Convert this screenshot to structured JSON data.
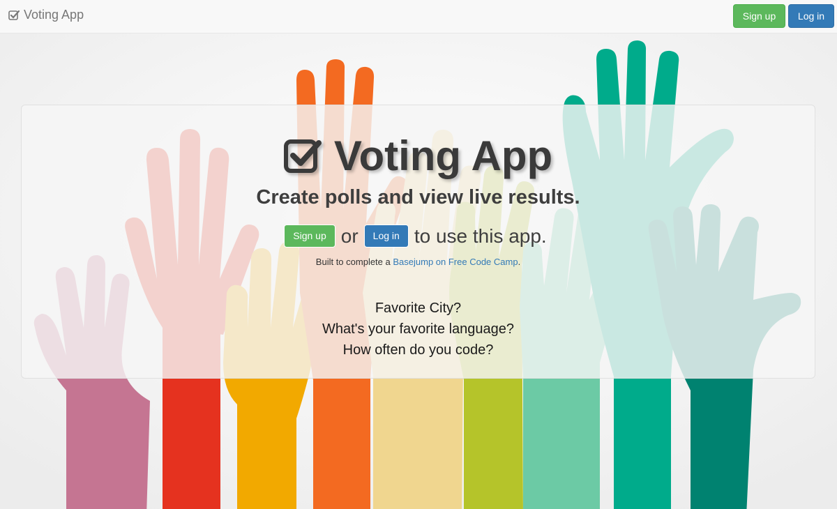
{
  "navbar": {
    "brand": "Voting App",
    "signup_label": "Sign up",
    "login_label": "Log in"
  },
  "hero": {
    "title": "Voting App",
    "subtitle": "Create polls and view live results.",
    "signup_label": "Sign up",
    "or_text": "or",
    "login_label": "Log in",
    "tail_text": "to use this app.",
    "built_prefix": "Built to complete a",
    "built_link": "Basejump on Free Code Camp",
    "built_suffix": "."
  },
  "polls": [
    "Favorite City?",
    "What's your favorite language?",
    "How often do you code?"
  ],
  "colors": {
    "success": "#5cb85c",
    "primary": "#337ab7",
    "link": "#337ab7"
  },
  "icons": {
    "brand": "check-square-icon"
  }
}
